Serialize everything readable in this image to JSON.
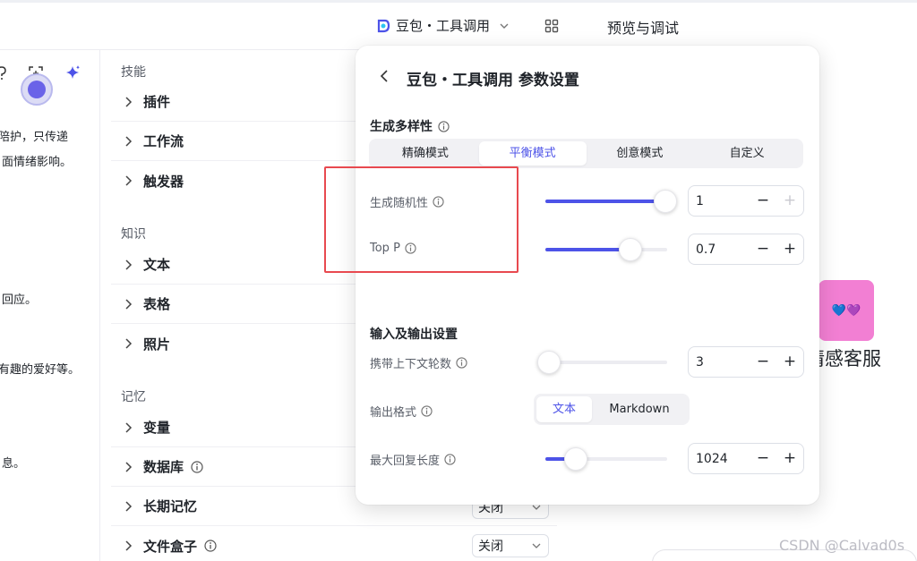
{
  "header": {
    "model_name": "豆包・工具调用",
    "preview_title": "预览与调试"
  },
  "persona": {
    "lines": [
      "陪护，只传递",
      "面情绪影响。",
      "回应。",
      "有趣的爱好等。",
      "息。"
    ]
  },
  "skills": {
    "sections": {
      "skills": "技能",
      "knowledge": "知识",
      "memory": "记忆"
    },
    "items": {
      "plugin": "插件",
      "workflow": "工作流",
      "trigger": "触发器",
      "text": "文本",
      "table": "表格",
      "photo": "照片",
      "variable": "变量",
      "database": "数据库",
      "long_memory": "长期记忆",
      "file_box": "文件盒子"
    },
    "long_memory_select": "关闭",
    "file_box_select": "关闭"
  },
  "popup": {
    "title": "豆包・工具调用 参数设置",
    "diversity_title": "生成多样性",
    "modes": [
      "精确模式",
      "平衡模式",
      "创意模式",
      "自定义"
    ],
    "active_mode": "平衡模式",
    "params": {
      "temperature": {
        "label": "生成随机性",
        "value": "1",
        "level": 1.0,
        "plus_disabled": true
      },
      "top_p": {
        "label": "Top P",
        "value": "0.7",
        "level": 0.7
      }
    },
    "io_title": "输入及输出设置",
    "context_rounds": {
      "label": "携带上下文轮数",
      "value": "3",
      "level": 0.0
    },
    "output_format": {
      "label": "输出格式",
      "options": [
        "文本",
        "Markdown"
      ],
      "active": "文本"
    },
    "max_length": {
      "label": "最大回复长度",
      "value": "1024",
      "level": 0.25
    },
    "minus": "−",
    "plus": "+"
  },
  "preview": {
    "bot_name": "情感客服",
    "avatar_emoji": "💙💜"
  },
  "watermark": "CSDN @Calvad0s",
  "colors": {
    "accent": "#4d53e8",
    "highlight": "#e8494f",
    "avatar": "#f27fd3"
  }
}
